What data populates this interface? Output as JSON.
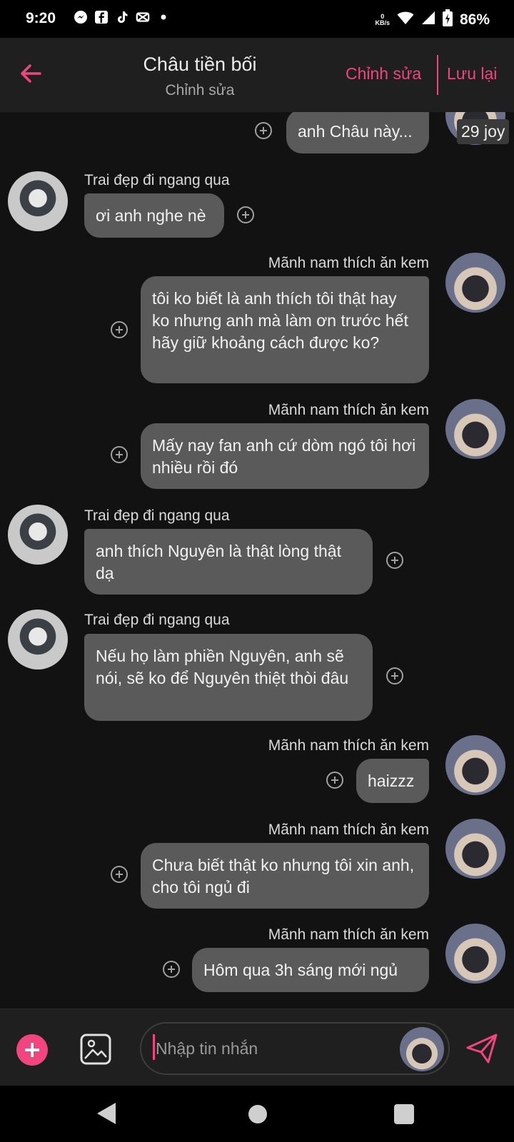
{
  "status_bar": {
    "time": "9:20",
    "net_speed_value": "0",
    "net_speed_unit": "KB/s",
    "battery": "86%",
    "notification_icons": [
      "messenger-icon",
      "facebook-icon",
      "tiktok-icon",
      "capcut-icon",
      "dot-icon"
    ]
  },
  "header": {
    "title": "Châu tiền bối",
    "subtitle": "Chỉnh sửa",
    "edit_label": "Chỉnh sửa",
    "save_label": "Lưu lại"
  },
  "messages": [
    {
      "side": "right",
      "sender": "",
      "text": "anh Châu này...",
      "badge": "29 joy"
    },
    {
      "side": "left",
      "sender": "Trai đẹp đi ngang qua",
      "text": "ơi anh nghe nè"
    },
    {
      "side": "right",
      "sender": "Mãnh nam thích ăn kem",
      "text": "tôi ko biết là anh thích tôi thật hay ko nhưng anh mà làm ơn trước hết hãy giữ khoảng cách được ko?"
    },
    {
      "side": "right",
      "sender": "Mãnh nam thích ăn kem",
      "text": "Mấy nay fan anh cứ dòm ngó tôi hơi nhiều rồi đó"
    },
    {
      "side": "left",
      "sender": "Trai đẹp đi ngang qua",
      "text": "anh thích Nguyên là thật lòng thật dạ"
    },
    {
      "side": "left",
      "sender": "Trai đẹp đi ngang qua",
      "text": "Nếu họ làm phiền Nguyên, anh sẽ nói, sẽ ko để Nguyên thiệt thòi đâu"
    },
    {
      "side": "right",
      "sender": "Mãnh nam thích ăn kem",
      "text": "haizzz"
    },
    {
      "side": "right",
      "sender": "Mãnh nam thích ăn kem",
      "text": "Chưa biết thật ko nhưng tôi xin anh, cho tôi ngủ đi"
    },
    {
      "side": "right",
      "sender": "Mãnh nam thích ăn kem",
      "text": "Hôm qua 3h sáng mới ngủ"
    }
  ],
  "input": {
    "placeholder": "Nhập tin nhắn"
  },
  "colors": {
    "accent": "#f0457f",
    "bubble": "#5a5a5a",
    "background": "#121212",
    "header": "#1f1f1f"
  }
}
